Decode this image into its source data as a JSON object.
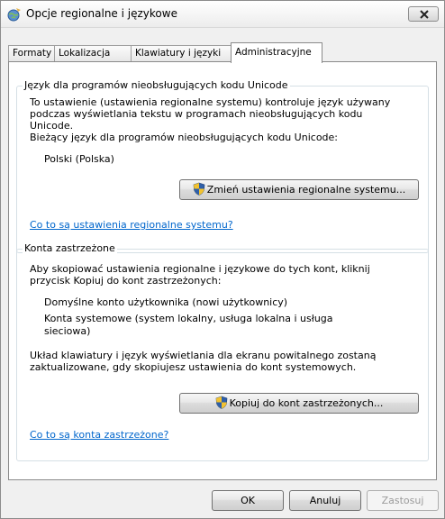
{
  "window": {
    "title": "Opcje regionalne i językowe"
  },
  "tabs": [
    {
      "label": "Formaty",
      "active": false
    },
    {
      "label": "Lokalizacja",
      "active": false
    },
    {
      "label": "Klawiatury i języki",
      "active": false
    },
    {
      "label": "Administracyjne",
      "active": true
    }
  ],
  "unicode_group": {
    "legend": "Język dla programów nieobsługujących kodu Unicode",
    "description_lines": [
      "To ustawienie (ustawienia regionalne systemu) kontroluje język używany",
      "podczas wyświetlania tekstu w programach nieobsługujących kodu",
      "Unicode."
    ],
    "current_label": "Bieżący język dla programów nieobsługujących kodu Unicode:",
    "current_value": "Polski (Polska)",
    "change_button": "Zmień ustawienia regionalne systemu...",
    "help_link": "Co to są ustawienia regionalne systemu?"
  },
  "reserved_group": {
    "legend": "Konta zastrzeżone",
    "description_lines": [
      "Aby skopiować ustawienia regionalne i językowe do tych kont, kliknij",
      "przycisk Kopiuj do kont zastrzeżonych:"
    ],
    "accounts": [
      "Domyślne konto użytkownika (nowi użytkownicy)",
      "Konta systemowe (system lokalny, usługa lokalna i usługa",
      "sieciowa)"
    ],
    "note_lines": [
      "Układ klawiatury i język wyświetlania dla ekranu powitalnego zostaną",
      "zaktualizowane, gdy skopiujesz ustawienia do kont systemowych."
    ],
    "copy_button": "Kopiuj do kont zastrzeżonych...",
    "help_link": "Co to są konta zastrzeżone?"
  },
  "footer": {
    "ok": "OK",
    "cancel": "Anuluj",
    "apply": "Zastosuj"
  },
  "icons": {
    "title": "globe-icon",
    "shield": "uac-shield-icon",
    "close": "close-icon"
  },
  "colors": {
    "link": "#0066cc",
    "shield_blue": "#2f5fa8",
    "shield_yellow": "#f2c230"
  }
}
